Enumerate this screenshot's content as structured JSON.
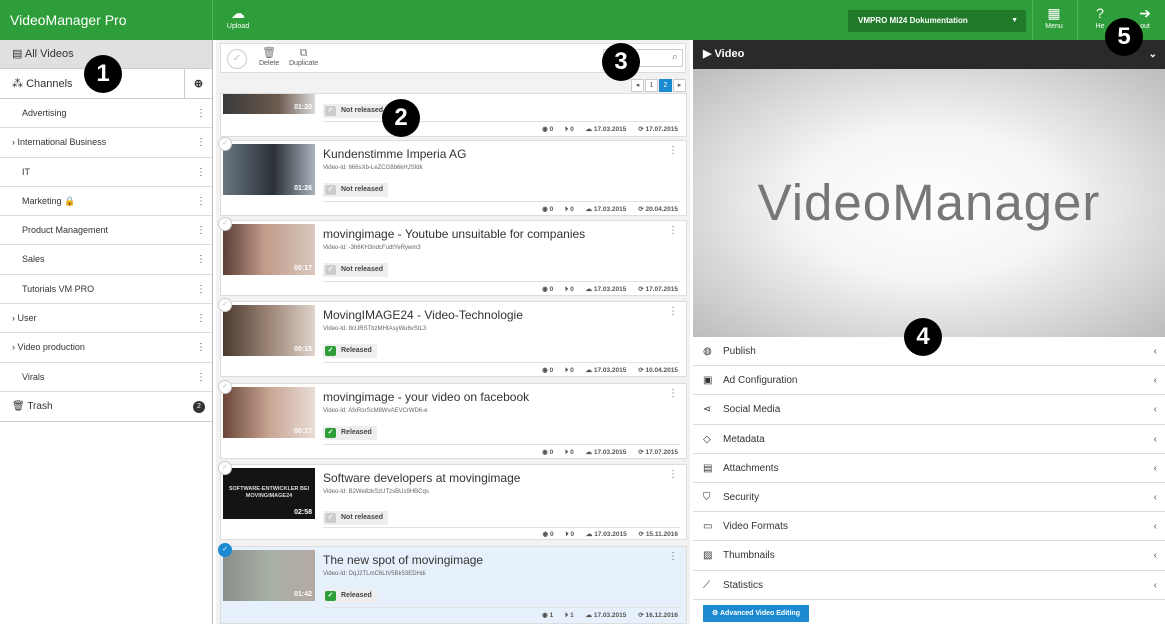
{
  "topbar": {
    "brand": "VideoManager Pro",
    "upload_label": "Upload",
    "project": "VMPRO MI24 Dokumentation",
    "menu_label": "Menu",
    "help_label": "He",
    "logout_label": "out"
  },
  "sidebar": {
    "all_videos": "All Videos",
    "channels": "Channels",
    "items": [
      {
        "label": "Advertising"
      },
      {
        "label": "International Business"
      },
      {
        "label": "IT"
      },
      {
        "label": "Marketing"
      },
      {
        "label": "Product Management"
      },
      {
        "label": "Sales"
      },
      {
        "label": "Tutorials VM PRO"
      },
      {
        "label": "User"
      },
      {
        "label": "Video production"
      },
      {
        "label": "Virals"
      }
    ],
    "trash": "Trash",
    "trash_count": "2"
  },
  "list_toolbar": {
    "delete_label": "Delete",
    "duplicate_label": "Duplicate",
    "search_placeholder": "",
    "pages": [
      "1",
      "2"
    ]
  },
  "videos": [
    {
      "title": "",
      "id": "",
      "duration": "01:20",
      "status": "Not released",
      "views": "0",
      "plays": "0",
      "uploaded": "17.03.2015",
      "updated": "17.07.2015"
    },
    {
      "title": "Kundenstimme Imperia AG",
      "id": "Video-Id: 666sXb-LeZCG8b6kHJSfdk",
      "duration": "01:26",
      "status": "Not released",
      "views": "0",
      "plays": "0",
      "uploaded": "17.03.2015",
      "updated": "20.04.2015"
    },
    {
      "title": "movingimage - Youtube unsuitable for companies",
      "id": "Video-Id: -3h6KH3ndcFudtYeRywm3",
      "duration": "00:17",
      "status": "Not released",
      "views": "0",
      "plays": "0",
      "uploaded": "17.03.2015",
      "updated": "17.07.2015"
    },
    {
      "title": "MovingIMAGE24 - Video-Technologie",
      "id": "Video-Id: 8cURSTbzMHtAsyWu6vStL3",
      "duration": "00:15",
      "status": "Released",
      "views": "0",
      "plays": "0",
      "uploaded": "17.03.2015",
      "updated": "10.04.2015"
    },
    {
      "title": "movingimage - your video on facebook",
      "id": "Video-Id: AfxRorScM8WvAEVCrWD6-e",
      "duration": "00:17",
      "status": "Released",
      "views": "0",
      "plays": "0",
      "uploaded": "17.03.2015",
      "updated": "17.07.2015"
    },
    {
      "title": "Software developers at movingimage",
      "id": "Video-Id: B2We8zkSzUTzsBUs9HBCqs",
      "duration": "02:58",
      "status": "Not released",
      "views": "0",
      "plays": "0",
      "uploaded": "17.03.2015",
      "updated": "15.11.2016",
      "thumb_text": "SOFTWARE-ENTWICKLER BEI MOVINGIMAGE24"
    },
    {
      "title": "The new spot of movingimage",
      "id": "Video-Id: DqJ2TLmC6LtV5Bk53EDHdi",
      "duration": "01:42",
      "status": "Released",
      "views": "1",
      "plays": "1",
      "uploaded": "17.03.2015",
      "updated": "16.12.2016"
    }
  ],
  "right": {
    "header": "Video",
    "player_text": "VideoManager",
    "sections": [
      {
        "label": "Publish",
        "icon": "globe-icon"
      },
      {
        "label": "Ad Configuration",
        "icon": "ad-icon"
      },
      {
        "label": "Social Media",
        "icon": "share-icon"
      },
      {
        "label": "Metadata",
        "icon": "tag-icon"
      },
      {
        "label": "Attachments",
        "icon": "file-icon"
      },
      {
        "label": "Security",
        "icon": "shield-icon"
      },
      {
        "label": "Video Formats",
        "icon": "monitor-icon"
      },
      {
        "label": "Thumbnails",
        "icon": "image-icon"
      },
      {
        "label": "Statistics",
        "icon": "chart-icon"
      }
    ],
    "advanced_button": "Advanced Video Editing"
  },
  "markers": [
    "1",
    "2",
    "3",
    "4",
    "5"
  ],
  "colors": {
    "topbar": "#2e9e3a",
    "accent": "#1b8ad1",
    "released": "#2e9e3a"
  }
}
